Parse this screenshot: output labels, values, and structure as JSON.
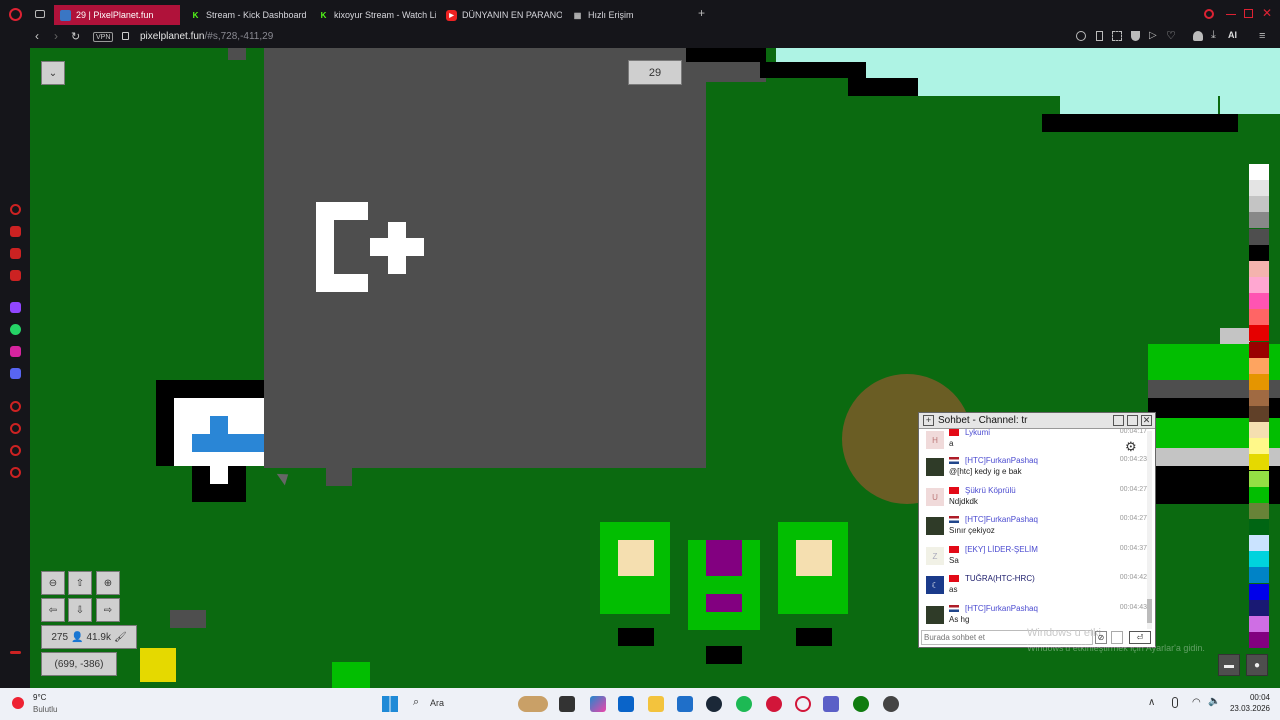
{
  "browser": {
    "tabs": [
      {
        "label": "29 | PixelPlanet.fun",
        "active": true,
        "icon": "pixelplanet-icon"
      },
      {
        "label": "Stream - Kick Dashboard",
        "active": false,
        "icon": "kick-icon"
      },
      {
        "label": "kixoyur Stream - Watch Li",
        "active": false,
        "icon": "kick-icon"
      },
      {
        "label": "DÜNYANIN EN PARANORM",
        "active": false,
        "icon": "youtube-icon"
      },
      {
        "label": "Hızlı Erişim",
        "active": false,
        "icon": "grid-icon"
      }
    ],
    "vpn_label": "VPN",
    "url_host": "pixelplanet.fun",
    "url_path": "/#s,728,-411,29",
    "ai_label": "AI"
  },
  "canvas": {
    "online_count_label": "29",
    "stats_users": "275",
    "stats_pixels": "41.9k",
    "coordinates": "(699, -386)"
  },
  "chat": {
    "title": "Sohbet - Channel: tr",
    "input_placeholder": "Burada sohbet et",
    "messages": [
      {
        "name": "Lykumi",
        "text": "a",
        "time": "00:04:17",
        "avatar": "H",
        "flag": "tr"
      },
      {
        "name": "[HTC]FurkanPashaq",
        "text": "@[htc] kedy ig e bak",
        "time": "00:04:23",
        "avatar": "img",
        "flag": "nl"
      },
      {
        "name": "Şükrü Köprülü",
        "text": "Ndjdkdk",
        "time": "00:04:27",
        "avatar": "U",
        "flag": "tr"
      },
      {
        "name": "[HTC]FurkanPashaq",
        "text": "Sınır çekiyoz",
        "time": "00:04:27",
        "avatar": "img",
        "flag": "nl"
      },
      {
        "name": "[EKY] LİDER-ŞELİM",
        "text": "Sa",
        "time": "00:04:37",
        "avatar": "Z",
        "flag": "tr"
      },
      {
        "name": "TUĞRA(HTC-HRC)",
        "text": "as",
        "time": "00:04:42",
        "avatar": "moon",
        "flag": "tr"
      },
      {
        "name": "[HTC]FurkanPashaq",
        "text": "As hg",
        "time": "00:04:43",
        "avatar": "img",
        "flag": "nl"
      }
    ],
    "watermark_line1": "Windows u etki",
    "watermark_line2": "Windows'u etkinleştirmek için Ayarlar'a gidin."
  },
  "palette": [
    "#ffffff",
    "#e4e4e4",
    "#c4c4c4",
    "#888888",
    "#4e4e4e",
    "#000000",
    "#f4b3ae",
    "#ffa7d1",
    "#ff54b2",
    "#ff6565",
    "#e50000",
    "#9a0000",
    "#fea460",
    "#e59500",
    "#a06a42",
    "#604028",
    "#f5dfb0",
    "#fff889",
    "#e5d900",
    "#94e044",
    "#02be01",
    "#688338",
    "#006513",
    "#cae3ff",
    "#00d3dd",
    "#0083c7",
    "#0000ea",
    "#191973",
    "#cf6ee4",
    "#820080"
  ],
  "taskbar": {
    "weather_temp": "9°C",
    "weather_desc": "Bulutlu",
    "search_label": "Ara",
    "clock_time": "00:04",
    "clock_date": "23.03.2026"
  }
}
